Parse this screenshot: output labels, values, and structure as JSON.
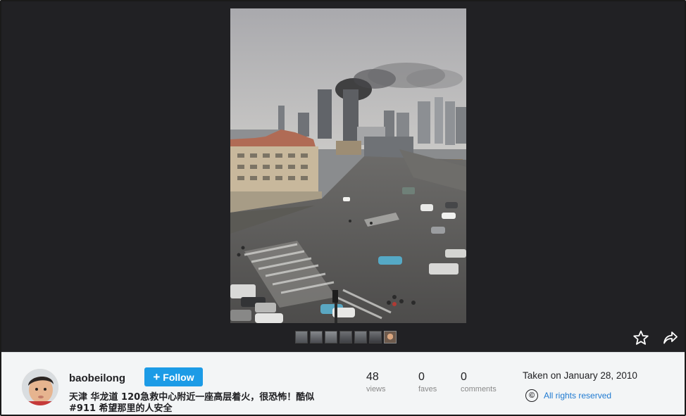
{
  "photo": {
    "alt_semantic": "city-street-fire-smoke-photo"
  },
  "thumbnails": [
    "thumb-1",
    "thumb-2",
    "thumb-3",
    "thumb-4",
    "thumb-5",
    "thumb-6",
    "thumb-7"
  ],
  "actions": {
    "favorite_icon": "star-icon",
    "share_icon": "share-arrow-icon"
  },
  "owner": {
    "username": "baobeilong",
    "follow_label": "Follow",
    "follow_icon": "+"
  },
  "description": "天津 华龙道 120急救中心附近一座高层着火，很恐怖！酷似#911 希望那里的人安全",
  "stats": {
    "views": {
      "value": "48",
      "label": "views"
    },
    "faves": {
      "value": "0",
      "label": "faves"
    },
    "comments": {
      "value": "0",
      "label": "comments"
    }
  },
  "taken": "Taken on January 28, 2010",
  "license": {
    "icon": "©",
    "text": "All rights reserved"
  },
  "colors": {
    "viewer_bg": "#212124",
    "follow_blue": "#1c9be6",
    "link_blue": "#1f7ad1",
    "info_bg": "#f3f5f6"
  }
}
